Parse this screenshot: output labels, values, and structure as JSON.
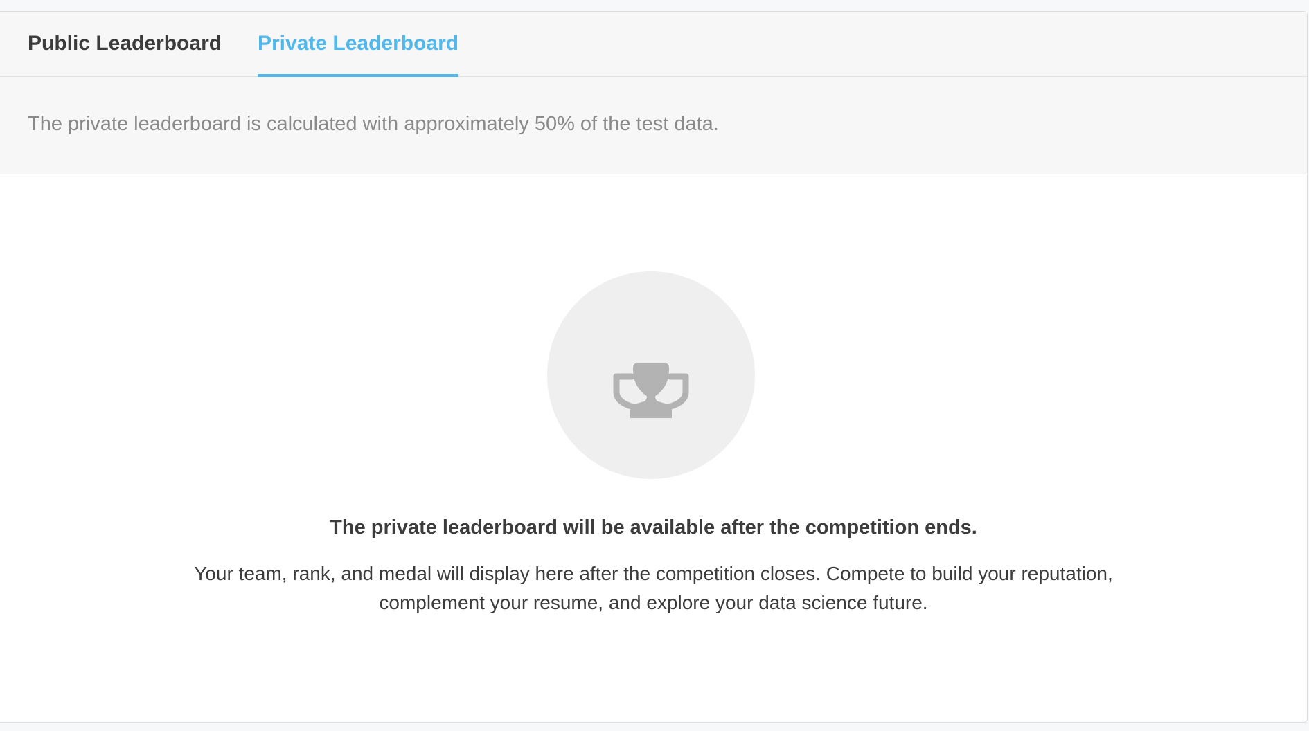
{
  "tabs": [
    {
      "label": "Public Leaderboard",
      "active": false
    },
    {
      "label": "Private Leaderboard",
      "active": true
    }
  ],
  "info_text": "The private leaderboard is calculated with approximately 50% of the test data.",
  "empty_state": {
    "icon": "trophy-icon",
    "title": "The private leaderboard will be available after the competition ends.",
    "body_line_1": "Your team, rank, and medal will display here after the competition closes. Compete to build your reputation,",
    "body_line_2": "complement your resume, and explore your data science future."
  },
  "colors": {
    "accent": "#52b8ec",
    "text_dark": "#3c3c3c",
    "text_muted": "#8a8a8a",
    "icon": "#b3b3b3",
    "icon_bg": "#efefef"
  }
}
